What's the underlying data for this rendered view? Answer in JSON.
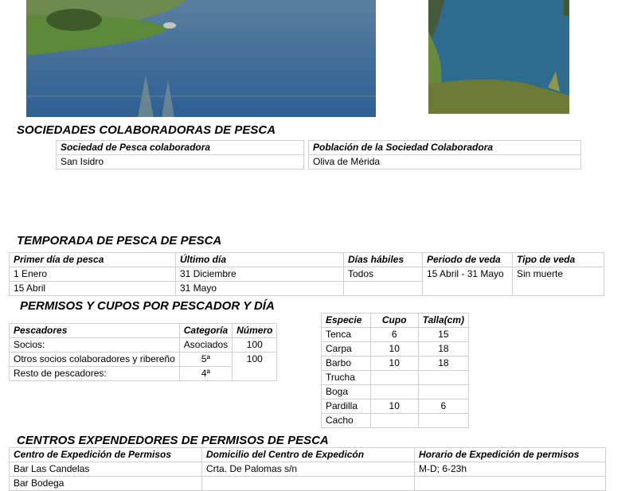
{
  "sections": {
    "sociedades": "SOCIEDADES COLABORADORAS DE PESCA",
    "temporada": "TEMPORADA DE PESCA DE PESCA",
    "permisos": "PERMISOS Y CUPOS POR PESCADOR Y DÍA",
    "centros": "CENTROS EXPENDEDORES DE PERMISOS DE PESCA"
  },
  "sociedades_table": {
    "headers": [
      "Sociedad de Pesca colaboradora",
      "Población de la Sociedad Colaboradora"
    ],
    "rows": [
      [
        "San Isidro",
        "Oliva de Mérida"
      ]
    ]
  },
  "temporada_table": {
    "headers": [
      "Primer día de pesca",
      "Último día",
      "Días hábiles",
      "Periodo de veda",
      "Tipo de veda"
    ],
    "row1": [
      "1 Enero",
      "31 Diciembre",
      "Todos",
      "15 Abril - 31 Mayo",
      "Sin muerte"
    ],
    "row2": [
      "15 Abril",
      "31 Mayo"
    ]
  },
  "pescadores_table": {
    "headers": [
      "Pescadores",
      "Categoría",
      "Número"
    ],
    "rows": [
      [
        "Socios:",
        "Asociados",
        "100"
      ],
      [
        "Otros socios colaboradores y ribereño",
        "5ª",
        "100"
      ],
      [
        "Resto de pescadores:",
        "4ª",
        ""
      ]
    ]
  },
  "especies_table": {
    "headers": [
      "Especie",
      "Cupo",
      "Talla(cm)"
    ],
    "rows": [
      [
        "Tenca",
        "6",
        "15"
      ],
      [
        "Carpa",
        "10",
        "18"
      ],
      [
        "Barbo",
        "10",
        "18"
      ],
      [
        "Trucha",
        "",
        ""
      ],
      [
        "Boga",
        "",
        ""
      ],
      [
        "Pardilla",
        "10",
        "6"
      ],
      [
        "Cacho",
        "",
        ""
      ]
    ]
  },
  "centros_table": {
    "headers": [
      "Centro de Expedición de Permisos",
      "Domicilio del Centro de Expedicón",
      "Horario de Expedición de permisos"
    ],
    "rows": [
      [
        "Bar Las Candelas",
        "Crta. De Palomas s/n",
        "M-D; 6-23h"
      ],
      [
        "Bar Bodega",
        "",
        ""
      ]
    ]
  }
}
